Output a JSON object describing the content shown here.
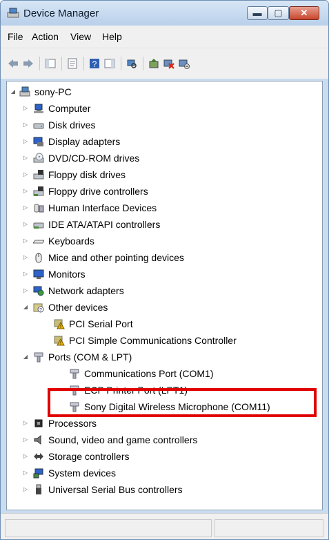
{
  "window": {
    "title": "Device Manager"
  },
  "menubar": {
    "items": [
      "File",
      "Action",
      "View",
      "Help"
    ]
  },
  "tree": {
    "root": "sony-PC",
    "categories": [
      {
        "label": "Computer",
        "icon": "computer-icon",
        "expanded": false
      },
      {
        "label": "Disk drives",
        "icon": "disk-drive-icon",
        "expanded": false
      },
      {
        "label": "Display adapters",
        "icon": "display-adapter-icon",
        "expanded": false
      },
      {
        "label": "DVD/CD-ROM drives",
        "icon": "dvd-drive-icon",
        "expanded": false
      },
      {
        "label": "Floppy disk drives",
        "icon": "floppy-drive-icon",
        "expanded": false
      },
      {
        "label": "Floppy drive controllers",
        "icon": "floppy-controller-icon",
        "expanded": false
      },
      {
        "label": "Human Interface Devices",
        "icon": "hid-icon",
        "expanded": false
      },
      {
        "label": "IDE ATA/ATAPI controllers",
        "icon": "ide-controller-icon",
        "expanded": false
      },
      {
        "label": "Keyboards",
        "icon": "keyboard-icon",
        "expanded": false
      },
      {
        "label": "Mice and other pointing devices",
        "icon": "mouse-icon",
        "expanded": false
      },
      {
        "label": "Monitors",
        "icon": "monitor-icon",
        "expanded": false
      },
      {
        "label": "Network adapters",
        "icon": "network-adapter-icon",
        "expanded": false
      },
      {
        "label": "Other devices",
        "icon": "other-devices-icon",
        "expanded": true,
        "children": [
          {
            "label": "PCI Serial Port",
            "icon": "warning-device-icon"
          },
          {
            "label": "PCI Simple Communications Controller",
            "icon": "warning-device-icon"
          }
        ]
      },
      {
        "label": "Ports (COM & LPT)",
        "icon": "port-icon",
        "expanded": true,
        "children": [
          {
            "label": "Communications Port (COM1)",
            "icon": "port-icon"
          },
          {
            "label": "ECP Printer Port (LPT1)",
            "icon": "port-icon"
          },
          {
            "label": "Sony Digital Wireless Microphone (COM11)",
            "icon": "port-icon"
          }
        ]
      },
      {
        "label": "Processors",
        "icon": "processor-icon",
        "expanded": false
      },
      {
        "label": "Sound, video and game controllers",
        "icon": "sound-icon",
        "expanded": false
      },
      {
        "label": "Storage controllers",
        "icon": "storage-controller-icon",
        "expanded": false
      },
      {
        "label": "System devices",
        "icon": "system-devices-icon",
        "expanded": false
      },
      {
        "label": "Universal Serial Bus controllers",
        "icon": "usb-icon",
        "expanded": false
      }
    ]
  },
  "colors": {
    "highlight": "#e10000",
    "titlebar": "#c9dcf0",
    "warning": "#e8b400"
  }
}
